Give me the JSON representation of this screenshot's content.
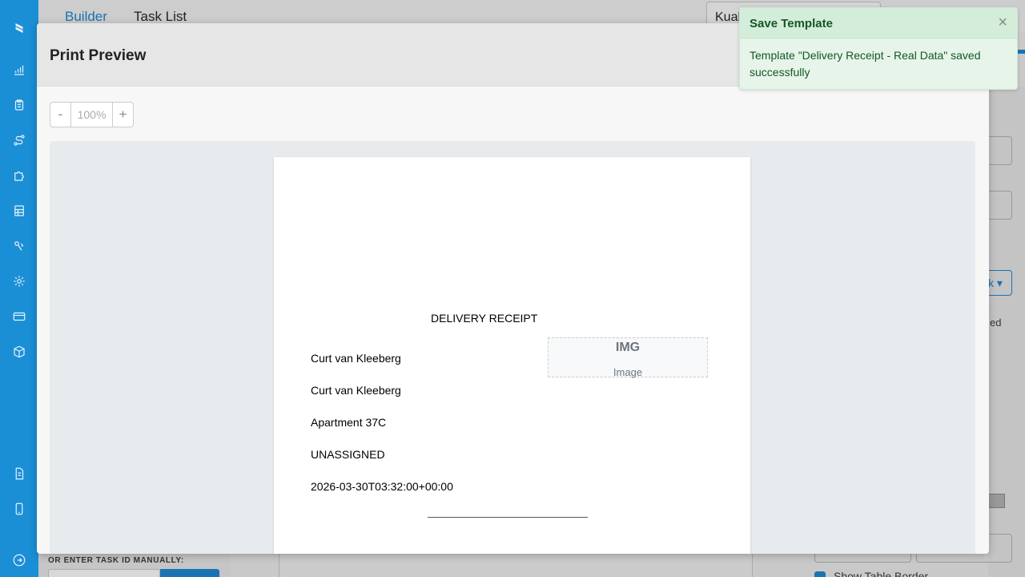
{
  "background": {
    "tabs": [
      {
        "label": "Builder",
        "active": true
      },
      {
        "label": "Task List",
        "active": false
      }
    ],
    "select_value": "Kual",
    "right_dropdown_label": "k",
    "right_text": "ed",
    "bottom_left_label": "OR ENTER TASK ID MANUALLY:",
    "show_table_border_label": "Show Table Border"
  },
  "sidebar": {
    "icons": [
      "logo-icon",
      "chart-icon",
      "clipboard-icon",
      "route-icon",
      "puzzle-icon",
      "table-icon",
      "gas-icon",
      "gear-icon",
      "card-icon",
      "box-icon",
      "document-icon",
      "phone-icon",
      "logout-icon"
    ]
  },
  "modal": {
    "title": "Print Preview",
    "zoom": {
      "minus": "-",
      "value": "100%",
      "plus": "+"
    },
    "receipt": {
      "title": "DELIVERY RECEIPT",
      "lines": [
        "Curt van Kleeberg",
        "Curt van Kleeberg",
        "Apartment 37C",
        "UNASSIGNED",
        "2026-03-30T03:32:00+00:00"
      ],
      "image_placeholder": {
        "big": "IMG",
        "small": "Image"
      }
    }
  },
  "toast": {
    "title": "Save Template",
    "close": "×",
    "message": "Template \"Delivery Receipt - Real Data\" saved successfully"
  },
  "colors": {
    "sidebar": "#1a8fd6",
    "toast_bg": "#e6f4ea",
    "toast_text": "#155724",
    "accent": "#1a73b3"
  }
}
